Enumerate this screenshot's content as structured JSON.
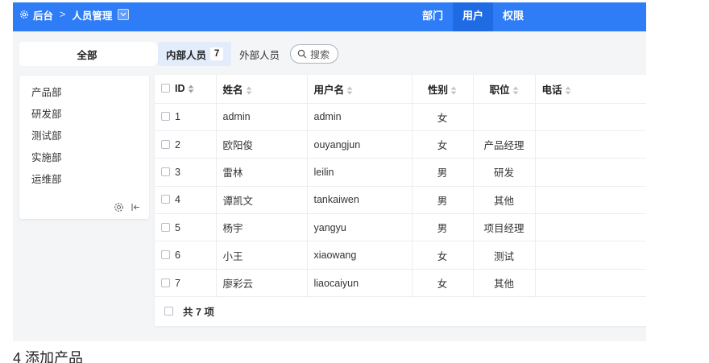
{
  "breadcrumb": {
    "root": "后台",
    "separator": ">",
    "current": "人员管理"
  },
  "top_nav": [
    {
      "label": "部门",
      "active": false
    },
    {
      "label": "用户",
      "active": true
    },
    {
      "label": "权限",
      "active": false
    }
  ],
  "sidebar": {
    "all_label": "全部",
    "items": [
      "产品部",
      "研发部",
      "测试部",
      "实施部",
      "运维部"
    ]
  },
  "tabs": [
    {
      "label": "内部人员",
      "count": "7",
      "active": true
    },
    {
      "label": "外部人员",
      "active": false
    }
  ],
  "search": {
    "label": "搜索"
  },
  "table": {
    "headers": [
      "ID",
      "姓名",
      "用户名",
      "性别",
      "职位",
      "电话"
    ],
    "rows": [
      {
        "id": "1",
        "name": "admin",
        "username": "admin",
        "gender": "女",
        "position": "",
        "phone": ""
      },
      {
        "id": "2",
        "name": "欧阳俊",
        "username": "ouyangjun",
        "gender": "女",
        "position": "产品经理",
        "phone": ""
      },
      {
        "id": "3",
        "name": "雷林",
        "username": "leilin",
        "gender": "男",
        "position": "研发",
        "phone": ""
      },
      {
        "id": "4",
        "name": "谭凯文",
        "username": "tankaiwen",
        "gender": "男",
        "position": "其他",
        "phone": ""
      },
      {
        "id": "5",
        "name": "杨宇",
        "username": "yangyu",
        "gender": "男",
        "position": "项目经理",
        "phone": ""
      },
      {
        "id": "6",
        "name": "小王",
        "username": "xiaowang",
        "gender": "女",
        "position": "测试",
        "phone": ""
      },
      {
        "id": "7",
        "name": "廖彩云",
        "username": "liaocaiyun",
        "gender": "女",
        "position": "其他",
        "phone": ""
      }
    ],
    "footer": "共 7 项"
  },
  "caption": "4 添加产品",
  "colors": {
    "primary": "#2f7df6",
    "primary_dark": "#1f6be4",
    "tab_active_bg": "#e3ecfb",
    "page_bg": "#f4f5f7"
  }
}
